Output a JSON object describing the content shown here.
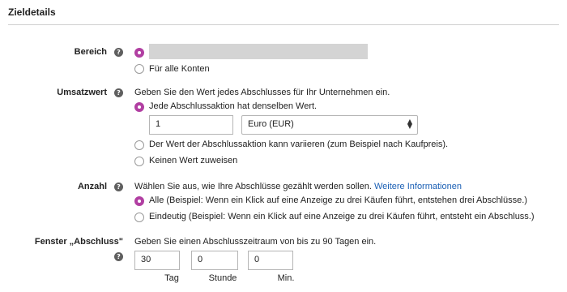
{
  "section": {
    "title": "Zieldetails"
  },
  "bereich": {
    "label": "Bereich",
    "option_all": "Für alle Konten"
  },
  "umsatzwert": {
    "label": "Umsatzwert",
    "description": "Geben Sie den Wert jedes Abschlusses für Ihr Unternehmen ein.",
    "option_same": "Jede Abschlussaktion hat denselben Wert.",
    "value_input": "1",
    "currency_select": "Euro (EUR)",
    "option_vary": "Der Wert der Abschlussaktion kann variieren (zum Beispiel nach Kaufpreis).",
    "option_none": "Keinen Wert zuweisen"
  },
  "anzahl": {
    "label": "Anzahl",
    "description": "Wählen Sie aus, wie Ihre Abschlüsse gezählt werden sollen.",
    "link": "Weitere Informationen",
    "option_all": "Alle (Beispiel: Wenn ein Klick auf eine Anzeige zu drei Käufen führt, entstehen drei Abschlüsse.)",
    "option_unique": "Eindeutig (Beispiel: Wenn ein Klick auf eine Anzeige zu drei Käufen führt, entsteht ein Abschluss.)"
  },
  "fenster": {
    "label": "Fenster „Abschluss\"",
    "description": "Geben Sie einen Abschlusszeitraum von bis zu 90 Tagen ein.",
    "days_value": "30",
    "hours_value": "0",
    "minutes_value": "0",
    "days_unit": "Tag",
    "hours_unit": "Stunde",
    "minutes_unit": "Min."
  },
  "icons": {
    "help": "?",
    "select_chevron": "▲\n▼"
  },
  "colors": {
    "radio_selected": "#b13fa2",
    "link": "#1a5fb4"
  }
}
